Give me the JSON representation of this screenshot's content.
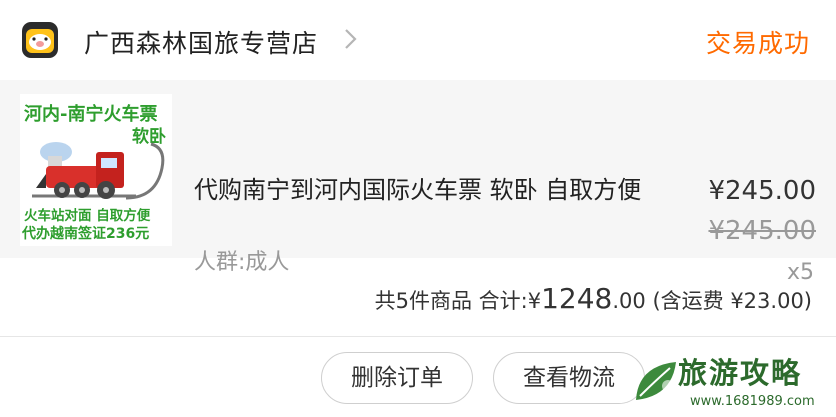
{
  "header": {
    "shop_name": "广西森林国旅专营店",
    "status": "交易成功"
  },
  "item": {
    "thumbnail": {
      "line1": "河内-南宁火车票",
      "line2": "软卧",
      "line3": "火车站对面 自取方便",
      "line4": "代办越南签证236元"
    },
    "title": "代购南宁到河内国际火车票 软卧 自取方便",
    "audience": "人群:成人",
    "price": "¥245.00",
    "original_price": "¥245.00",
    "quantity": "x5"
  },
  "summary": {
    "count_text": "共5件商品",
    "total_label": "合计:",
    "currency": "¥",
    "total_int": "1248",
    "total_dec": ".00",
    "shipping": "(含运费 ¥23.00)"
  },
  "actions": {
    "delete_label": "删除订单",
    "logistics_label": "查看物流"
  },
  "watermark": {
    "title": "旅游攻略",
    "url": "www.1681989.com"
  },
  "colors": {
    "accent": "#ff6a00",
    "item_bg": "#f6f6f6",
    "muted": "#999999"
  }
}
